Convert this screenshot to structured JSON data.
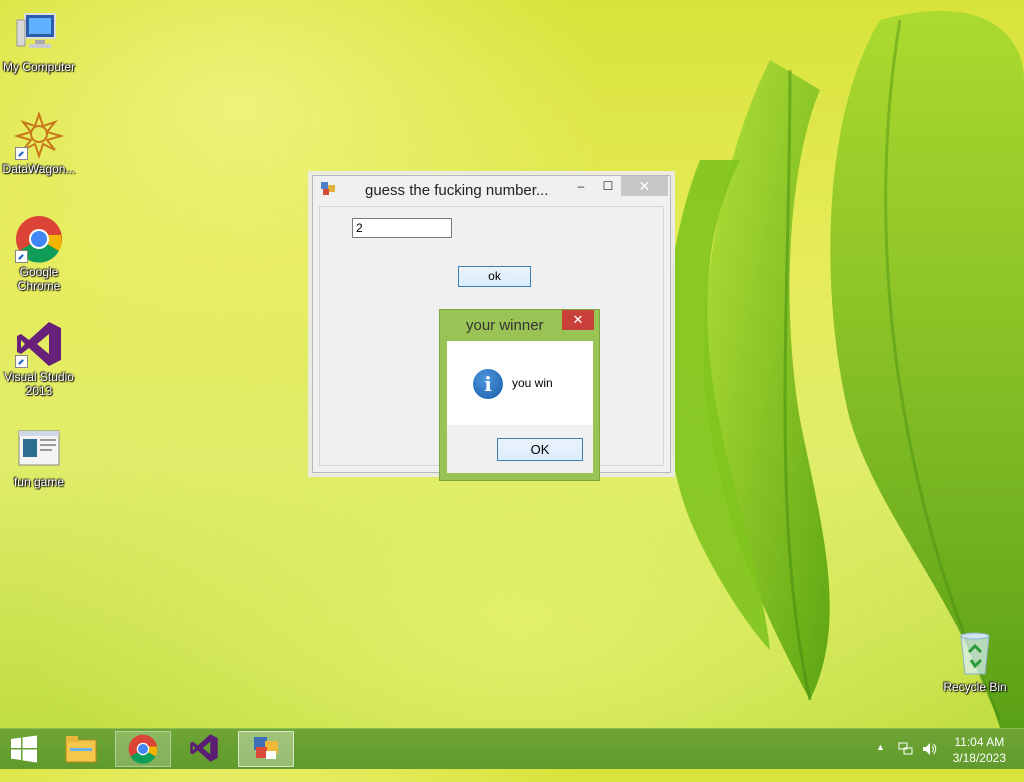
{
  "desktop": {
    "icons": [
      {
        "label": "My Computer"
      },
      {
        "label": "DataWagon..."
      },
      {
        "label": "Google\nChrome"
      },
      {
        "label": "Visual Studio\n2013"
      },
      {
        "label": "fun game"
      },
      {
        "label": "Recycle Bin"
      }
    ]
  },
  "main_window": {
    "title": "guess the fucking number...",
    "controls": {
      "minimize": "–",
      "maximize": "☐",
      "close": "✕"
    },
    "number_value": "2",
    "ok_label": "ok"
  },
  "message_box": {
    "title": "your winner",
    "close": "✕",
    "icon": "information-icon",
    "message": "you win",
    "ok_label": "OK"
  },
  "taskbar": {
    "items": [
      "start-button",
      "file-explorer",
      "google-chrome",
      "visual-studio",
      "fun-game"
    ],
    "tray": {
      "chevron": "▲"
    },
    "clock": {
      "time": "11:04 AM",
      "date": "3/18/2023"
    }
  },
  "colors": {
    "taskbar": "#6fa535",
    "msgbox_frame": "#9ac356",
    "msgbox_close": "#c9403a"
  }
}
